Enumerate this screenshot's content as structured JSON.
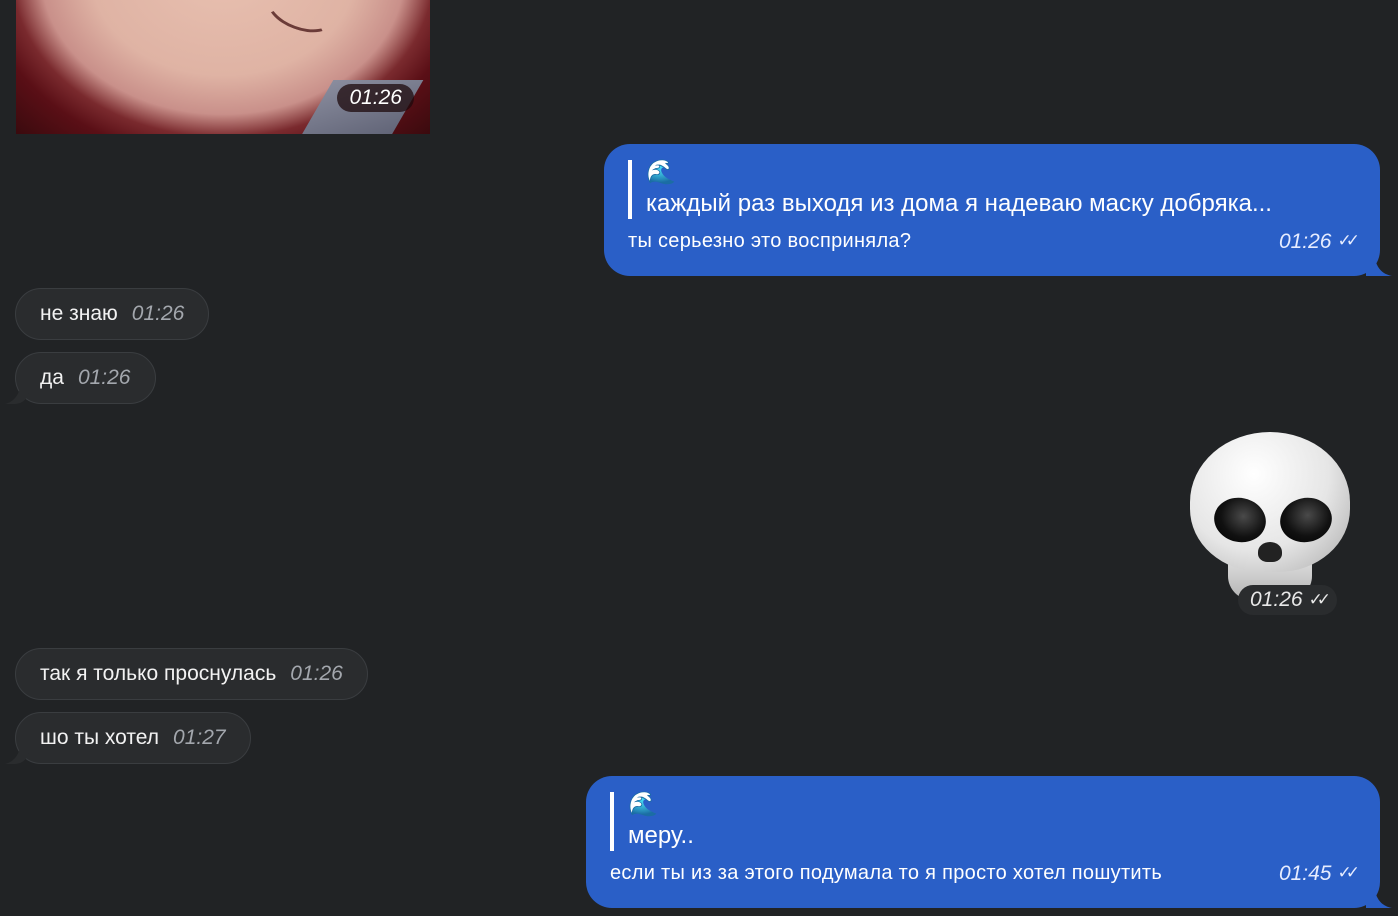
{
  "image_message": {
    "time": "01:26"
  },
  "out_message_1": {
    "reply_emoji": "🌊",
    "reply_text": "каждый раз выходя из дома я надеваю маску добряка...",
    "text": "ты серьезно это восприняла?",
    "time": "01:26",
    "status_icon": "double-check-icon"
  },
  "in_message_1": {
    "text": "не знаю",
    "time": "01:26"
  },
  "in_message_2": {
    "text": "да",
    "time": "01:26"
  },
  "sticker_message": {
    "emoji_name": "skull-icon",
    "time": "01:26",
    "status_icon": "double-check-icon"
  },
  "in_message_3": {
    "text": "так я только проснулась",
    "time": "01:26"
  },
  "in_message_4": {
    "text": "шо ты хотел",
    "time": "01:27"
  },
  "out_message_2": {
    "reply_emoji": "🌊",
    "reply_text": "меру..",
    "text": "если ты из за этого подумала то я просто хотел пошутить",
    "time": "01:45",
    "status_icon": "double-check-icon"
  },
  "colors": {
    "background": "#212325",
    "incoming_bubble": "#2a2c2e",
    "outgoing_bubble": "#2a5fc7"
  }
}
